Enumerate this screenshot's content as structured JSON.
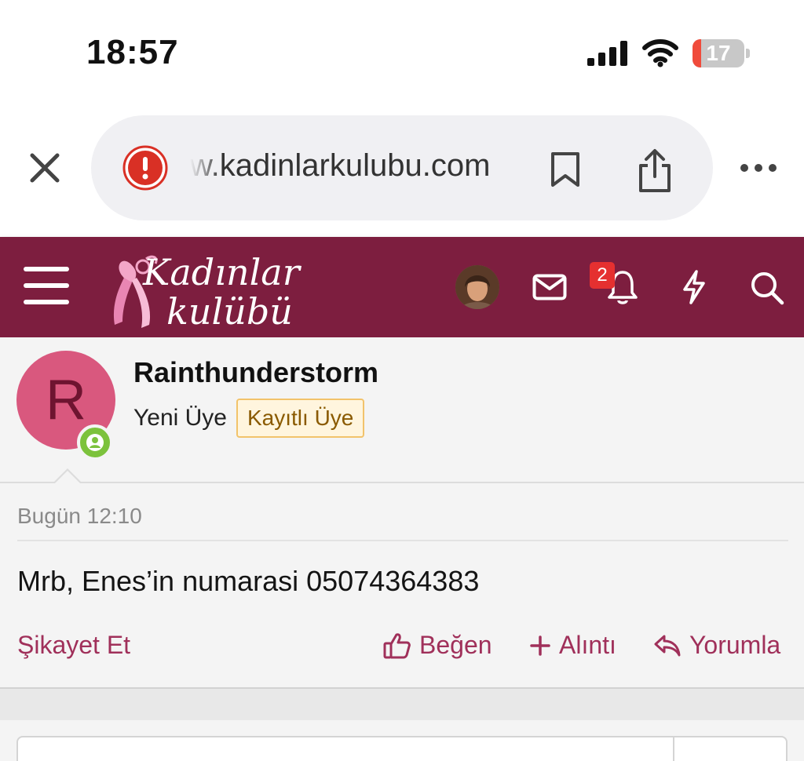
{
  "status_bar": {
    "time": "18:57",
    "battery_level": "17",
    "battery_fraction": 0.17,
    "icons": [
      "signal-icon",
      "wifi-icon",
      "battery-icon"
    ]
  },
  "browser": {
    "url": "w.kadinlarkulubu.com",
    "icons": [
      "close-icon",
      "alert-icon",
      "bookmark-icon",
      "share-icon",
      "more-icon"
    ]
  },
  "site_header": {
    "logo_line1": "Kadınlar",
    "logo_line2": "kulübü",
    "notification_count": "2",
    "icons": [
      "menu-icon",
      "mail-icon",
      "bell-icon",
      "bolt-icon",
      "search-icon"
    ],
    "brand_color": "#7d1e3f"
  },
  "post": {
    "avatar_letter": "R",
    "username": "Rainthunderstorm",
    "user_title": "Yeni Üye",
    "user_banner": "Kayıtlı Üye",
    "date": "Bugün 12:10",
    "body": "Mrb, Enes’in numarasi 05074364383",
    "actions": {
      "report": "Şikayet Et",
      "like": "Beğen",
      "quote": "Alıntı",
      "reply": "Yorumla"
    },
    "accent_color": "#a0305a",
    "avatar_color": "#d9587e"
  }
}
